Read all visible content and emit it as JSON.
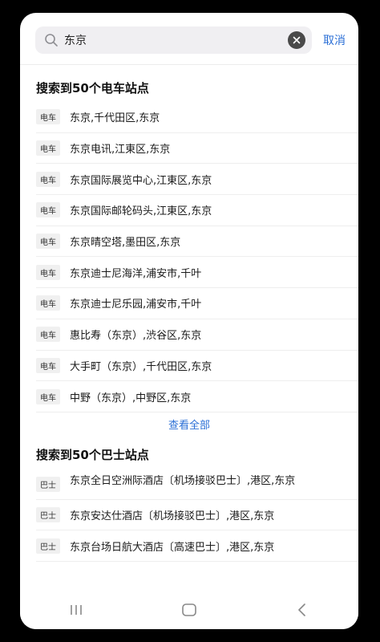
{
  "search": {
    "value": "东京",
    "cancel_label": "取消"
  },
  "train_section": {
    "title": "搜索到50个电车站点",
    "items": [
      {
        "badge": "电车",
        "label": "东京,千代田区,东京"
      },
      {
        "badge": "电车",
        "label": "东京电讯,江東区,东京"
      },
      {
        "badge": "电车",
        "label": "东京国际展览中心,江東区,东京"
      },
      {
        "badge": "电车",
        "label": "东京国际邮轮码头,江東区,东京"
      },
      {
        "badge": "电车",
        "label": "东京晴空塔,墨田区,东京"
      },
      {
        "badge": "电车",
        "label": "东京迪士尼海洋,浦安市,千叶"
      },
      {
        "badge": "电车",
        "label": "东京迪士尼乐园,浦安市,千叶"
      },
      {
        "badge": "电车",
        "label": "惠比寿（东京）,渋谷区,东京"
      },
      {
        "badge": "电车",
        "label": "大手町（东京）,千代田区,东京"
      },
      {
        "badge": "电车",
        "label": "中野（东京）,中野区,东京"
      }
    ],
    "view_all": "查看全部"
  },
  "bus_section": {
    "title": "搜索到50个巴士站点",
    "items": [
      {
        "badge": "巴士",
        "label": "东京全日空洲际酒店〔机场接驳巴士〕,港区,东京"
      },
      {
        "badge": "巴士",
        "label": "东京安达仕酒店〔机场接驳巴士〕,港区,东京"
      },
      {
        "badge": "巴士",
        "label": "东京台场日航大酒店〔高速巴士〕,港区,东京"
      }
    ]
  },
  "icons": {
    "search": "search-icon",
    "clear": "clear-icon",
    "recents": "recents-icon",
    "home": "home-icon",
    "back": "back-icon"
  },
  "colors": {
    "accent": "#2b6fd6",
    "badge_bg": "#f0f0f0",
    "search_bg": "#f0eff2"
  }
}
